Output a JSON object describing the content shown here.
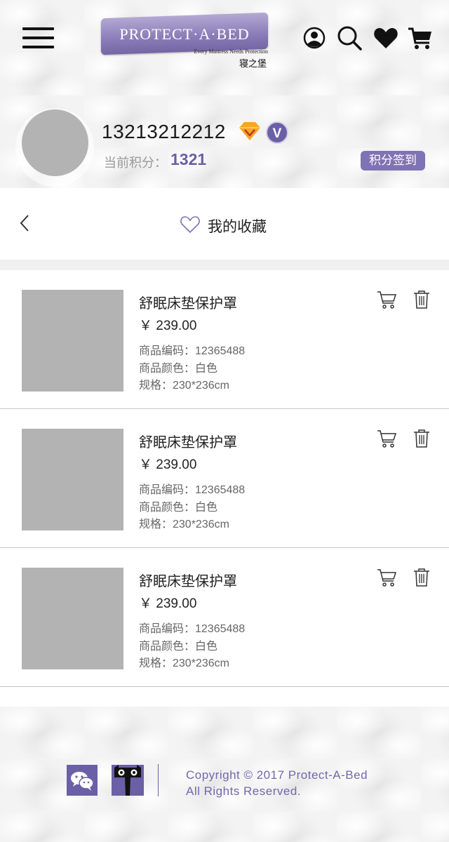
{
  "header": {
    "logo_text": "PROTECT·A·BED",
    "logo_tagline": "Every Mattress Needs Protection",
    "logo_cn": "寝之堡"
  },
  "profile": {
    "username": "13213212212",
    "points_label": "当前积分：",
    "points_value": "1321",
    "signin_label": "积分签到",
    "vip_letter": "V"
  },
  "page": {
    "title": "我的收藏"
  },
  "favorites": [
    {
      "name": "舒眠床垫保护罩",
      "price": "￥ 239.00",
      "code": "商品编码：12365488",
      "color": "商品颜色：白色",
      "size": "规格：230*236cm"
    },
    {
      "name": "舒眠床垫保护罩",
      "price": "￥ 239.00",
      "code": "商品编码：12365488",
      "color": "商品颜色：白色",
      "size": "规格：230*236cm"
    },
    {
      "name": "舒眠床垫保护罩",
      "price": "￥ 239.00",
      "code": "商品编码：12365488",
      "color": "商品颜色：白色",
      "size": "规格：230*236cm"
    }
  ],
  "footer": {
    "copyright_line1": "Copyright  © 2017 Protect-A-Bed",
    "copyright_line2": "All Rights Reserved."
  },
  "colors": {
    "brand_purple": "#7f73b3",
    "points_purple": "#6b5fa6",
    "diamond_gold": "#f5a623",
    "placeholder_gray": "#b3b3b3"
  },
  "icons": [
    "menu-icon",
    "user-icon",
    "search-icon",
    "heart-icon",
    "cart-icon",
    "diamond-icon",
    "vip-icon",
    "back-icon",
    "cart-add-icon",
    "trash-icon",
    "wechat-icon",
    "tmall-icon"
  ]
}
